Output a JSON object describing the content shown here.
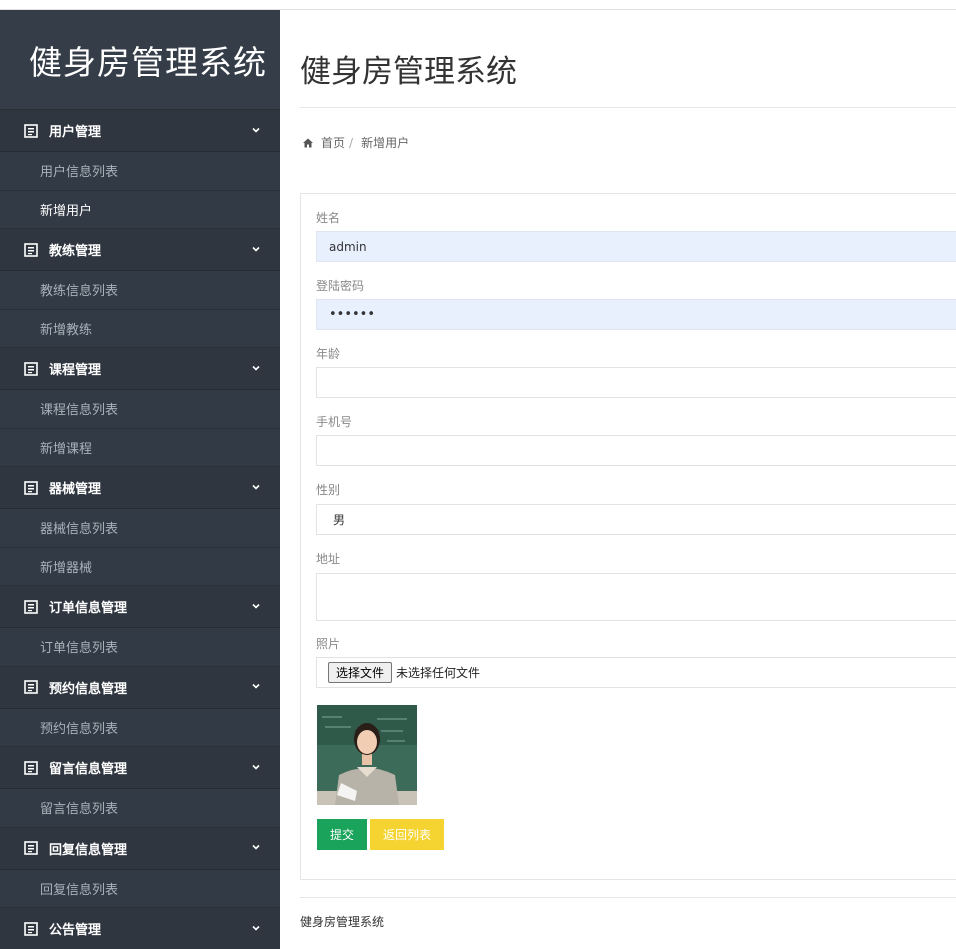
{
  "app": {
    "brand": "健身房管理系统"
  },
  "sidebar": {
    "sections": [
      {
        "title": "用户管理",
        "items": [
          "用户信息列表",
          "新增用户"
        ]
      },
      {
        "title": "教练管理",
        "items": [
          "教练信息列表",
          "新增教练"
        ]
      },
      {
        "title": "课程管理",
        "items": [
          "课程信息列表",
          "新增课程"
        ]
      },
      {
        "title": "器械管理",
        "items": [
          "器械信息列表",
          "新增器械"
        ]
      },
      {
        "title": "订单信息管理",
        "items": [
          "订单信息列表"
        ]
      },
      {
        "title": "预约信息管理",
        "items": [
          "预约信息列表"
        ]
      },
      {
        "title": "留言信息管理",
        "items": [
          "留言信息列表"
        ]
      },
      {
        "title": "回复信息管理",
        "items": [
          "回复信息列表"
        ]
      },
      {
        "title": "公告管理",
        "items": []
      }
    ],
    "active_item": "新增用户"
  },
  "main": {
    "title": "健身房管理系统",
    "breadcrumb": {
      "home": "首页",
      "separator": "/",
      "current": "新增用户"
    }
  },
  "form": {
    "name": {
      "label": "姓名",
      "value": "admin"
    },
    "password": {
      "label": "登陆密码",
      "value": "••••••"
    },
    "age": {
      "label": "年龄",
      "value": ""
    },
    "phone": {
      "label": "手机号",
      "value": ""
    },
    "gender": {
      "label": "性别",
      "value": "男"
    },
    "address": {
      "label": "地址",
      "value": ""
    },
    "photo": {
      "label": "照片",
      "button": "选择文件",
      "status": "未选择任何文件"
    },
    "submit": "提交",
    "back": "返回列表"
  },
  "footer": {
    "text": "健身房管理系统"
  },
  "colors": {
    "sidebar_bg": "#2f3640",
    "brand_bg": "#353d48",
    "submit_green": "#1aa35a",
    "back_yellow": "#f5d431",
    "autofill_blue": "#e8f0fe"
  },
  "icons": {
    "menu": "list-doc-icon",
    "chevron": "chevron-down-icon",
    "home": "home-icon"
  }
}
